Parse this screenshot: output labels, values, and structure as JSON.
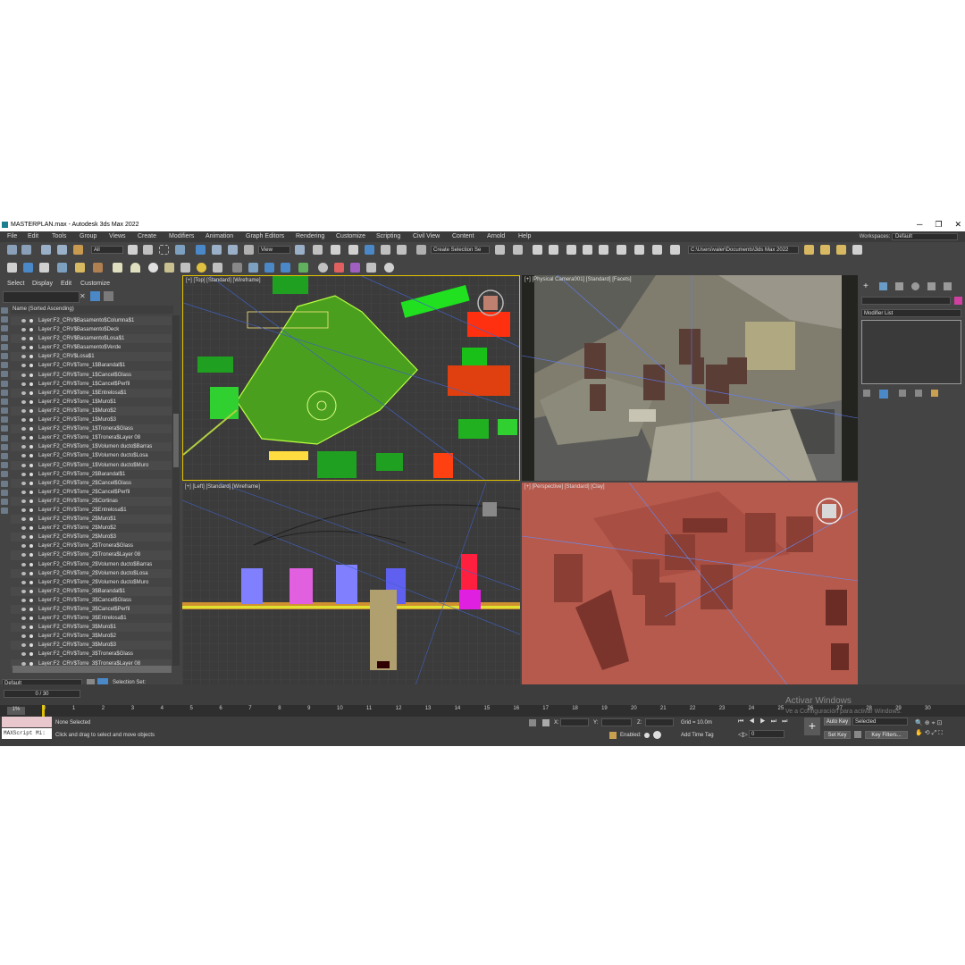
{
  "window": {
    "title": "MASTERPLAN.max - Autodesk 3ds Max 2022",
    "minimize": "─",
    "maximize": "❐",
    "close": "✕"
  },
  "menu": [
    "File",
    "Edit",
    "Tools",
    "Group",
    "Views",
    "Create",
    "Modifiers",
    "Animation",
    "Graph Editors",
    "Rendering",
    "Customize",
    "Scripting",
    "Civil View",
    "Content",
    "Arnold",
    "Help"
  ],
  "workspaces": {
    "label": "Workspaces:",
    "value": "Default"
  },
  "toolbar": {
    "filter_value": "All",
    "refcoord_value": "View",
    "selection_set_placeholder": "Create Selection Se",
    "project_path": "C:\\Users\\valer\\Documents\\3ds Max 2022"
  },
  "scene_explorer": {
    "tabs": [
      "Select",
      "Display",
      "Edit",
      "Customize"
    ],
    "column_header": "Name (Sorted Ascending)",
    "rows": [
      "Layer:F2_CRV$Basamento$Columna$1",
      "Layer:F2_CRV$Basamento$Deck",
      "Layer:F2_CRV$Basamento$Losa$1",
      "Layer:F2_CRV$Basamento$Verde",
      "Layer:F2_CRV$Losa$1",
      "Layer:F2_CRV$Torre_1$Barandal$1",
      "Layer:F2_CRV$Torre_1$Cancel$Glass",
      "Layer:F2_CRV$Torre_1$Cancel$Perfil",
      "Layer:F2_CRV$Torre_1$Entrelosa$1",
      "Layer:F2_CRV$Torre_1$Muro$1",
      "Layer:F2_CRV$Torre_1$Muro$2",
      "Layer:F2_CRV$Torre_1$Muro$3",
      "Layer:F2_CRV$Torre_1$Tronera$Glass",
      "Layer:F2_CRV$Torre_1$Tronera$Layer 08",
      "Layer:F2_CRV$Torre_1$Volumen ducto$Barras",
      "Layer:F2_CRV$Torre_1$Volumen ducto$Losa",
      "Layer:F2_CRV$Torre_1$Volumen ducto$Muro",
      "Layer:F2_CRV$Torre_2$Barandal$1",
      "Layer:F2_CRV$Torre_2$Cancel$Glass",
      "Layer:F2_CRV$Torre_2$Cancel$Perfil",
      "Layer:F2_CRV$Torre_2$Cortinas",
      "Layer:F2_CRV$Torre_2$Entrelosa$1",
      "Layer:F2_CRV$Torre_2$Muro$1",
      "Layer:F2_CRV$Torre_2$Muro$2",
      "Layer:F2_CRV$Torre_2$Muro$3",
      "Layer:F2_CRV$Torre_2$Tronera$Glass",
      "Layer:F2_CRV$Torre_2$Tronera$Layer 08",
      "Layer:F2_CRV$Torre_2$Volumen ducto$Barras",
      "Layer:F2_CRV$Torre_2$Volumen ducto$Losa",
      "Layer:F2_CRV$Torre_2$Volumen ducto$Muro",
      "Layer:F2_CRV$Torre_3$Barandal$1",
      "Layer:F2_CRV$Torre_3$Cancel$Glass",
      "Layer:F2_CRV$Torre_3$Cancel$Perfil",
      "Layer:F2_CRV$Torre_3$Entrelosa$1",
      "Layer:F2_CRV$Torre_3$Muro$1",
      "Layer:F2_CRV$Torre_3$Muro$2",
      "Layer:F2_CRV$Torre_3$Muro$3",
      "Layer:F2_CRV$Torre_3$Tronera$Glass",
      "Layer:F2_CRV$Torre_3$Tronera$Layer 08"
    ],
    "layer_value": "Default",
    "selection_set_label": "Selection Set:"
  },
  "viewports": {
    "top": "[+] [Top] [Standard] [Wireframe]",
    "camera": "[+] [Physical Camera001] [Standard] [Facets]",
    "left": "[+] [Left] [Standard] [Wireframe]",
    "perspective": "[+] [Perspective] [Standard] [Clay]"
  },
  "command_panel": {
    "modifier_list": "Modifier List"
  },
  "timeline": {
    "frame_counter": "0 / 30",
    "ticks": [
      "0",
      "1",
      "2",
      "3",
      "4",
      "5",
      "6",
      "7",
      "8",
      "9",
      "10",
      "11",
      "12",
      "13",
      "14",
      "15",
      "16",
      "17",
      "18",
      "19",
      "20",
      "21",
      "22",
      "23",
      "24",
      "25",
      "26",
      "27",
      "28",
      "29",
      "30"
    ]
  },
  "status": {
    "maxscript": "MAXScript Mi:",
    "selection": "None Selected",
    "prompt": "Click and drag to select and move objects",
    "x_label": "X:",
    "y_label": "Y:",
    "z_label": "Z:",
    "grid": "Grid = 10.0m",
    "enabled": "Enabled:",
    "add_time_tag": "Add Time Tag",
    "auto_key": "Auto Key",
    "set_key": "Set Key",
    "selected": "Selected",
    "key_filters": "Key Filters...",
    "frame_value": "0"
  },
  "windows_watermark": {
    "line1": "Activar Windows",
    "line2": "Ve a Configuración para activar Windows."
  },
  "colors": {
    "ui_bg": "#444444",
    "viewport_bg": "#3b3b3b",
    "clay": "#b65a4d",
    "active_border": "#e0c000"
  }
}
